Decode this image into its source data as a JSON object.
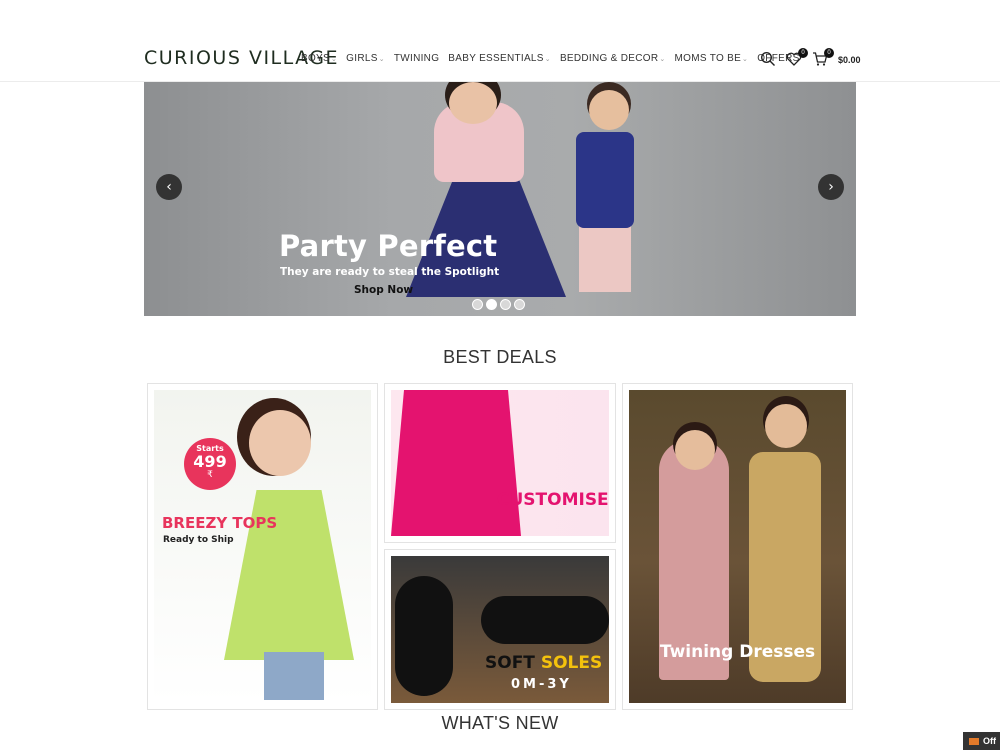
{
  "header": {
    "logo": "CURIOUS VILLAGE",
    "nav": [
      {
        "label": "BOYS",
        "has_dropdown": true
      },
      {
        "label": "GIRLS",
        "has_dropdown": true
      },
      {
        "label": "TWINING",
        "has_dropdown": false
      },
      {
        "label": "BABY ESSENTIALS",
        "has_dropdown": true
      },
      {
        "label": "BEDDING & DECOR",
        "has_dropdown": true
      },
      {
        "label": "MOMS TO BE",
        "has_dropdown": true
      },
      {
        "label": "OFFERS",
        "has_dropdown": false
      }
    ],
    "wishlist_count": "0",
    "cart_count": "0",
    "cart_total": "$0.00"
  },
  "hero": {
    "title": "Party Perfect",
    "subtitle": "They are ready to steal the Spotlight",
    "cta": "Shop Now",
    "prev_arrow": "‹",
    "next_arrow": "›",
    "slides": 4,
    "active_slide": 1
  },
  "best_deals": {
    "title": "BEST DEALS",
    "cards": [
      {
        "starts": "Starts",
        "price": "499",
        "currency": "₹",
        "headline": "BREEZY TOPS",
        "subline": "Ready to Ship"
      },
      {
        "headline": "CUSTOMISE"
      },
      {
        "headline_a": "SOFT ",
        "headline_b": "SOLES",
        "subline": "0M-3Y"
      },
      {
        "headline": "Twining Dresses"
      }
    ]
  },
  "whats_new": {
    "title": "WHAT'S NEW"
  },
  "offers_tab": {
    "label": "Off"
  },
  "colors": {
    "brand_green": "#7bbf2a",
    "accent_pink": "#e4136f",
    "dark": "#333333"
  }
}
